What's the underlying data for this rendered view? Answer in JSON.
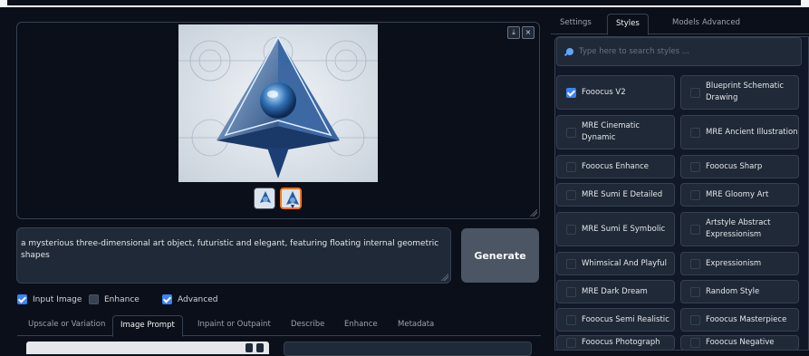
{
  "gallery": {
    "download_glyph": "⤓",
    "close_glyph": "×",
    "thumbnails": [
      "thumbnail-1",
      "thumbnail-2"
    ],
    "selected_thumbnail": 2
  },
  "prompt": {
    "value": "a mysterious three-dimensional art object, futuristic and elegant, featuring floating internal geometric shapes"
  },
  "generate_label": "Generate",
  "options": [
    {
      "label": "Input Image",
      "checked": true
    },
    {
      "label": "Enhance",
      "checked": false
    },
    {
      "label": "Advanced",
      "checked": true
    }
  ],
  "input_tabs": [
    {
      "label": "Upscale or Variation",
      "active": false
    },
    {
      "label": "Image Prompt",
      "active": true
    },
    {
      "label": "Inpaint or Outpaint",
      "active": false
    },
    {
      "label": "Describe",
      "active": false
    },
    {
      "label": "Enhance",
      "active": false
    },
    {
      "label": "Metadata",
      "active": false
    }
  ],
  "settings_tabs": [
    {
      "label": "Settings",
      "active": false
    },
    {
      "label": "Styles",
      "active": true
    },
    {
      "label": "Models",
      "active": false
    },
    {
      "label": "Advanced",
      "active": false
    }
  ],
  "style_search": {
    "placeholder": "Type here to search styles ..."
  },
  "styles": [
    {
      "label": "Fooocus V2",
      "checked": true
    },
    {
      "label": "Blueprint Schematic Drawing",
      "checked": false
    },
    {
      "label": "MRE Cinematic Dynamic",
      "checked": false
    },
    {
      "label": "MRE Ancient Illustration",
      "checked": false
    },
    {
      "label": "Fooocus Enhance",
      "checked": false
    },
    {
      "label": "Fooocus Sharp",
      "checked": false
    },
    {
      "label": "MRE Sumi E Detailed",
      "checked": false
    },
    {
      "label": "MRE Gloomy Art",
      "checked": false
    },
    {
      "label": "MRE Sumi E Symbolic",
      "checked": false
    },
    {
      "label": "Artstyle Abstract Expressionism",
      "checked": false
    },
    {
      "label": "Whimsical And Playful",
      "checked": false
    },
    {
      "label": "Expressionism",
      "checked": false
    },
    {
      "label": "MRE Dark Dream",
      "checked": false
    },
    {
      "label": "Random Style",
      "checked": false
    },
    {
      "label": "Fooocus Semi Realistic",
      "checked": false
    },
    {
      "label": "Fooocus Masterpiece",
      "checked": false
    },
    {
      "label": "Fooocus Photograph",
      "checked": false
    },
    {
      "label": "Fooocus Negative",
      "checked": false
    }
  ],
  "colors": {
    "accent": "#3b82f6",
    "selected_border": "#f97316",
    "background": "#0b0f19"
  }
}
